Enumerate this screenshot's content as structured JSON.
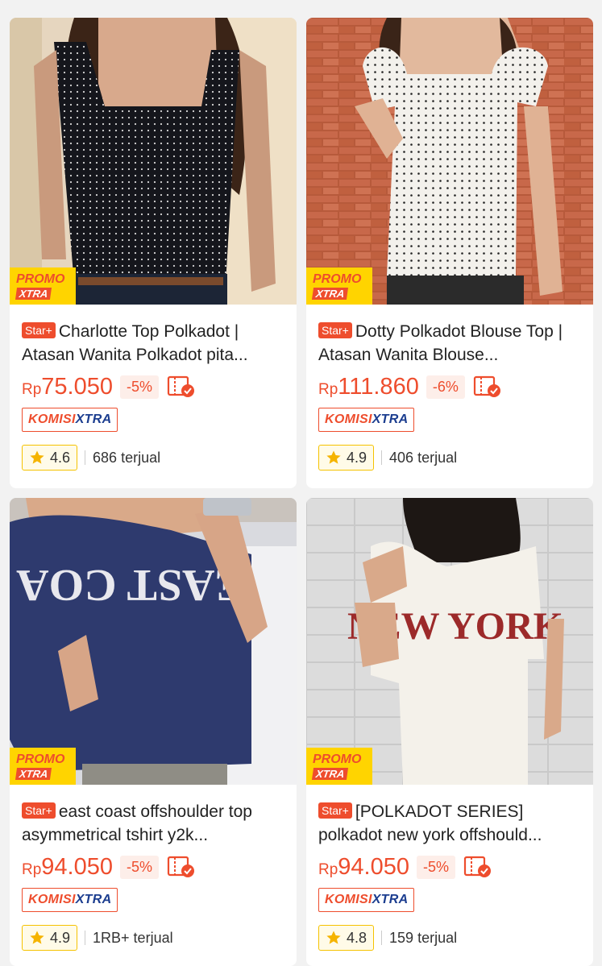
{
  "colors": {
    "accent": "#ee4d2d",
    "promo_yellow": "#ffd400",
    "komisi_blue": "#1b3d8f",
    "star": "#f5b400"
  },
  "products": [
    {
      "promo_line1": "PROMO",
      "promo_line2": "XTRA",
      "badge": "Star+",
      "title": "Charlotte Top Polkadot | Atasan Wanita Polkadot pita...",
      "currency": "Rp",
      "price": "75.050",
      "discount": "-5%",
      "komisi_1": "KOMISI",
      "komisi_2": "XTRA",
      "rating": "4.6",
      "sold": "686 terjual",
      "image_icon": "black-polkadot-top-photo"
    },
    {
      "promo_line1": "PROMO",
      "promo_line2": "XTRA",
      "badge": "Star+",
      "title": "Dotty Polkadot Blouse Top | Atasan Wanita Blouse...",
      "currency": "Rp",
      "price": "111.860",
      "discount": "-6%",
      "komisi_1": "KOMISI",
      "komisi_2": "XTRA",
      "rating": "4.9",
      "sold": "406 terjual",
      "image_icon": "white-polkadot-blouse-photo"
    },
    {
      "promo_line1": "PROMO",
      "promo_line2": "XTRA",
      "badge": "Star+",
      "title": "east coast offshoulder top asymmetrical tshirt y2k...",
      "currency": "Rp",
      "price": "94.050",
      "discount": "-5%",
      "komisi_1": "KOMISI",
      "komisi_2": "XTRA",
      "rating": "4.9",
      "sold": "1RB+ terjual",
      "image_icon": "navy-offshoulder-tshirt-photo"
    },
    {
      "promo_line1": "PROMO",
      "promo_line2": "XTRA",
      "badge": "Star+",
      "title": "[POLKADOT SERIES] polkadot new york offshould...",
      "currency": "Rp",
      "price": "94.050",
      "discount": "-5%",
      "komisi_1": "KOMISI",
      "komisi_2": "XTRA",
      "rating": "4.8",
      "sold": "159 terjual",
      "image_icon": "white-new-york-tshirt-photo"
    }
  ]
}
